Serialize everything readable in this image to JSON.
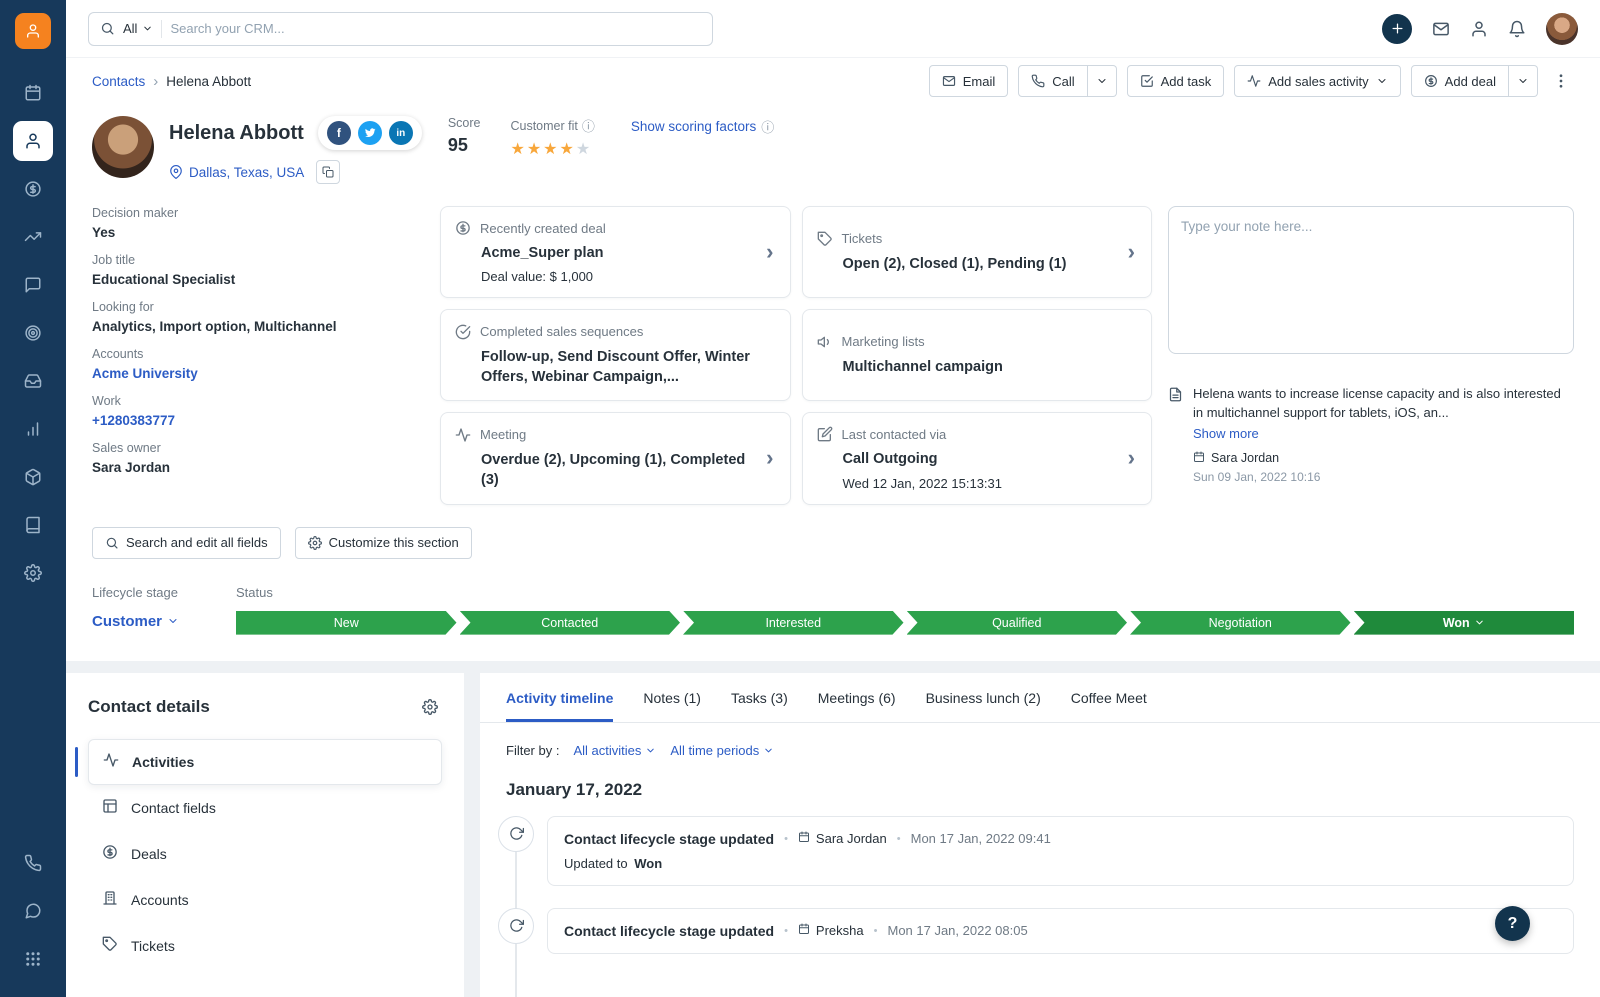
{
  "topbar": {
    "search_scope": "All",
    "search_placeholder": "Search your CRM..."
  },
  "breadcrumb": {
    "parent": "Contacts",
    "current": "Helena Abbott"
  },
  "actions": {
    "email": "Email",
    "call": "Call",
    "add_task": "Add task",
    "add_sales_activity": "Add sales activity",
    "add_deal": "Add deal"
  },
  "contact": {
    "name": "Helena Abbott",
    "location": "Dallas, Texas, USA",
    "score_label": "Score",
    "score": "95",
    "customer_fit_label": "Customer fit",
    "fit_stars": 4,
    "scoring_link": "Show scoring factors",
    "fields": [
      {
        "label": "Decision maker",
        "value": "Yes"
      },
      {
        "label": "Job title",
        "value": "Educational Specialist"
      },
      {
        "label": "Looking for",
        "value": "Analytics, Import option, Multichannel"
      },
      {
        "label": "Accounts",
        "value": "Acme University"
      },
      {
        "label": "Work",
        "value": "+1280383777"
      },
      {
        "label": "Sales owner",
        "value": "Sara Jordan"
      }
    ]
  },
  "cards": [
    {
      "title": "Recently created deal",
      "main": "Acme_Super plan",
      "sub": "Deal value: $ 1,000"
    },
    {
      "title": "Tickets",
      "main": "Open (2), Closed (1), Pending (1)"
    },
    {
      "title": "Completed sales sequences",
      "main": "Follow-up, Send Discount Offer, Winter Offers, Webinar Campaign,..."
    },
    {
      "title": "Marketing lists",
      "main": "Multichannel campaign"
    },
    {
      "title": "Meeting",
      "main": "Overdue (2), Upcoming (1), Completed (3)"
    },
    {
      "title": "Last contacted via",
      "main": "Call Outgoing",
      "sub": "Wed 12 Jan, 2022 15:13:31"
    }
  ],
  "notes": {
    "placeholder": "Type your note here...",
    "text": "Helena wants to increase license capacity and is also interested in multichannel support for tablets, iOS, an...",
    "show_more": "Show more",
    "author": "Sara Jordan",
    "time": "Sun 09 Jan, 2022 10:16"
  },
  "section_actions": {
    "search_fields": "Search and edit all fields",
    "customize": "Customize this section"
  },
  "lifecycle": {
    "label": "Lifecycle stage",
    "value": "Customer",
    "status_label": "Status",
    "stages": [
      "New",
      "Contacted",
      "Interested",
      "Qualified",
      "Negotiation",
      "Won"
    ]
  },
  "details_panel": {
    "title": "Contact details",
    "items": [
      "Activities",
      "Contact fields",
      "Deals",
      "Accounts",
      "Tickets"
    ]
  },
  "tabs": [
    "Activity timeline",
    "Notes (1)",
    "Tasks (3)",
    "Meetings (6)",
    "Business lunch (2)",
    "Coffee Meet"
  ],
  "filters": {
    "label": "Filter by :",
    "activities": "All activities",
    "periods": "All time periods"
  },
  "timeline": {
    "date": "January 17, 2022",
    "entries": [
      {
        "title": "Contact lifecycle stage updated",
        "author": "Sara Jordan",
        "time": "Mon 17 Jan, 2022 09:41",
        "detail_label": "Updated to",
        "detail_value": "Won"
      },
      {
        "title": "Contact lifecycle stage updated",
        "author": "Preksha",
        "time": "Mon 17 Jan, 2022 08:05"
      }
    ]
  },
  "help": {
    "label": "?"
  },
  "colors": {
    "accent_blue": "#2c5cc5",
    "sidebar_navy": "#17395b",
    "brand_orange": "#f5821f",
    "pipeline_green": "#2da24c",
    "pipeline_green_dark": "#1f8a3b",
    "star_orange": "#f8a73b"
  }
}
